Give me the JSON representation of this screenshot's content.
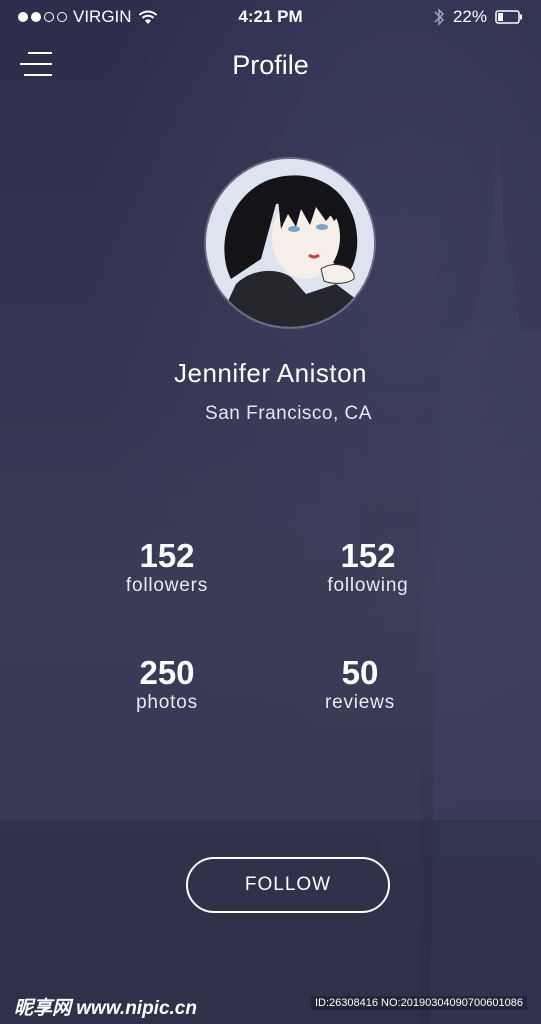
{
  "status_bar": {
    "carrier": "VIRGIN",
    "time": "4:21 PM",
    "battery": "22%",
    "signal_strength": 2,
    "signal_max": 5
  },
  "header": {
    "title": "Profile",
    "menu_icon": "hamburger-menu-icon"
  },
  "profile": {
    "name": "Jennifer Aniston",
    "location": "San Francisco, CA"
  },
  "stats": [
    {
      "value": "152",
      "label": "followers"
    },
    {
      "value": "152",
      "label": "following"
    },
    {
      "value": "250",
      "label": "photos"
    },
    {
      "value": "50",
      "label": "reviews"
    }
  ],
  "actions": {
    "follow_label": "FOLLOW"
  },
  "watermark": {
    "site": "昵享网 www.nipic.cn",
    "id": "ID:26308416 NO:20190304090700601086"
  },
  "colors": {
    "background": "#2f3150",
    "text": "#ffffff"
  }
}
